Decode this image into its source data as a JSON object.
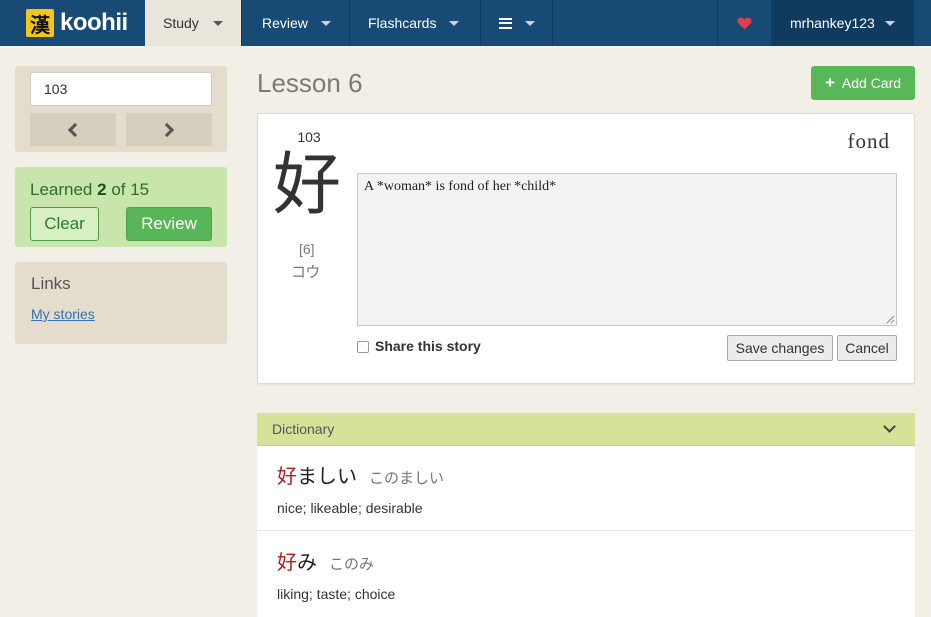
{
  "nav": {
    "logo_glyph": "漢",
    "logo_text": "koohii",
    "study": "Study",
    "review": "Review",
    "flashcards": "Flashcards",
    "username": "mrhankey123"
  },
  "sidebar": {
    "search_value": "103",
    "learned_prefix": "Learned ",
    "learned_count": "2",
    "learned_suffix": " of 15",
    "clear_label": "Clear",
    "review_label": "Review",
    "links_title": "Links",
    "my_stories": "My stories"
  },
  "main": {
    "lesson_title": "Lesson 6",
    "add_card_label": "Add Card",
    "frame_number": "103",
    "kanji": "好",
    "stroke_count": "[6]",
    "onyomi": "コウ",
    "keyword": "fond",
    "story_text": "A *woman* is fond of her *child*",
    "share_label": "Share this story",
    "save_label": "Save changes",
    "cancel_label": "Cancel"
  },
  "dictionary": {
    "title": "Dictionary",
    "entries": [
      {
        "kanji": "好",
        "rest": "ましい",
        "reading": "このましい",
        "meaning": "nice; likeable; desirable"
      },
      {
        "kanji": "好",
        "rest": "み",
        "reading": "このみ",
        "meaning": "liking; taste; choice"
      }
    ]
  },
  "colors": {
    "nav_bg": "#174a74",
    "accent_green": "#58b858",
    "kanji_highlight": "#b31c1c"
  }
}
